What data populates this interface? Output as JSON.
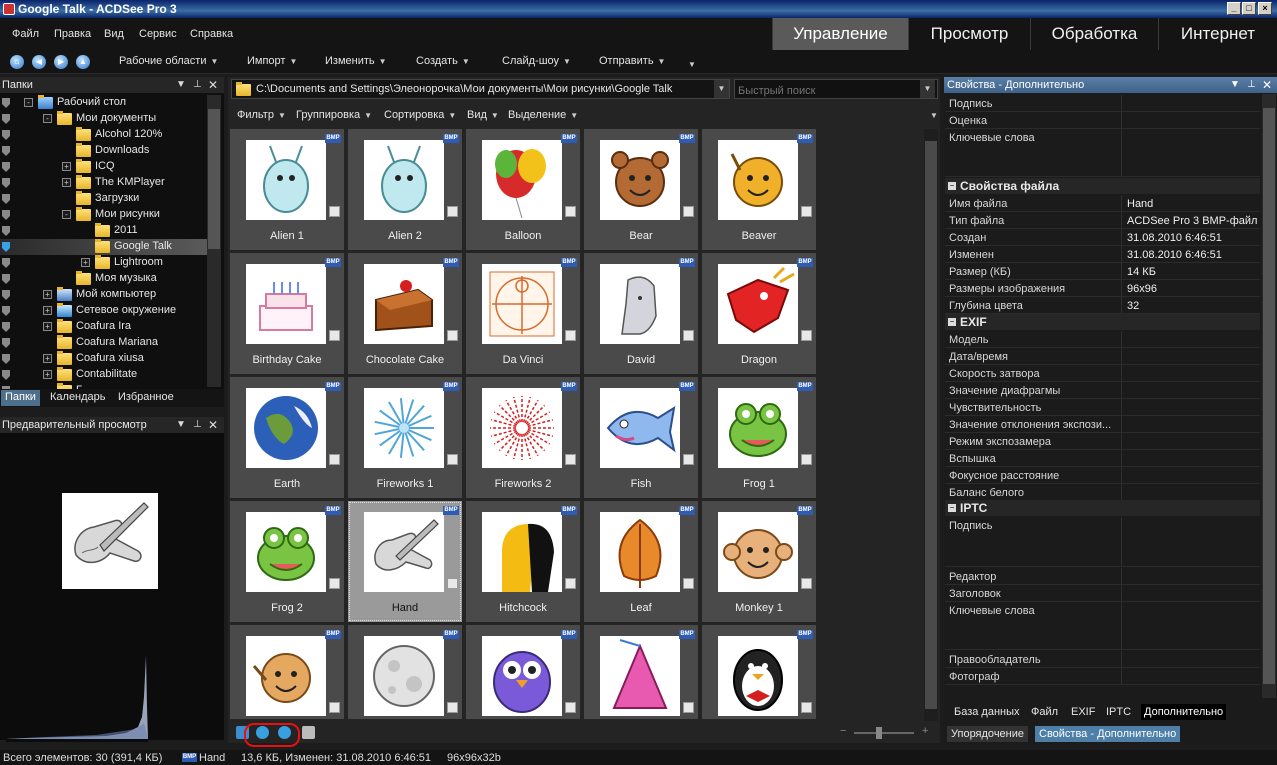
{
  "window": {
    "title": "Google Talk - ACDSee Pro 3"
  },
  "menu": [
    "Файл",
    "Правка",
    "Вид",
    "Сервис",
    "Справка"
  ],
  "modes": [
    "Управление",
    "Просмотр",
    "Обработка",
    "Интернет"
  ],
  "toolbar": [
    "Рабочие области",
    "Импорт",
    "Изменить",
    "Создать",
    "Слайд-шоу",
    "Отправить"
  ],
  "folders_panel": {
    "title": "Папки",
    "items": [
      "Рабочий стол",
      "Мои документы",
      "Alcohol 120%",
      "Downloads",
      "ICQ",
      "The KMPlayer",
      "Загрузки",
      "Мои рисунки",
      "2011",
      "Google Talk",
      "Lightroom",
      "Моя музыка",
      "Мой компьютер",
      "Сетевое окружение",
      "Coafura Ira",
      "Coafura Mariana",
      "Coafura xiusa",
      "Contabilitate",
      "Г"
    ]
  },
  "left_tabs": [
    "Папки",
    "Календарь",
    "Избранное"
  ],
  "preview_panel": {
    "title": "Предварительный просмотр"
  },
  "path": "C:\\Documents and Settings\\Элеонорочка\\Мои документы\\Мои рисунки\\Google Talk",
  "quick_search_placeholder": "Быстрый поиск",
  "filterbar": [
    "Фильтр",
    "Группировка",
    "Сортировка",
    "Вид",
    "Выделение"
  ],
  "badge_label": "BMP",
  "thumbnails": [
    "Alien 1",
    "Alien 2",
    "Balloon",
    "Bear",
    "Beaver",
    "Birthday Cake",
    "Chocolate Cake",
    "Da Vinci",
    "David",
    "Dragon",
    "Earth",
    "Fireworks 1",
    "Fireworks 2",
    "Fish",
    "Frog 1",
    "Frog 2",
    "Hand",
    "Hitchcock",
    "Leaf",
    "Monkey 1",
    "",
    "",
    "",
    "",
    ""
  ],
  "properties": {
    "title": "Свойства - Дополнительно",
    "top": [
      {
        "k": "Подпись",
        "v": ""
      },
      {
        "k": "Оценка",
        "v": ""
      },
      {
        "k": "Ключевые слова",
        "v": ""
      }
    ],
    "file_section": "Свойства файла",
    "file": [
      {
        "k": "Имя файла",
        "v": "Hand"
      },
      {
        "k": "Тип файла",
        "v": "ACDSee Pro 3 BMP-файл"
      },
      {
        "k": "Создан",
        "v": "31.08.2010 6:46:51"
      },
      {
        "k": "Изменен",
        "v": "31.08.2010 6:46:51"
      },
      {
        "k": "Размер (КБ)",
        "v": "14 КБ"
      },
      {
        "k": "Размеры изображения",
        "v": "96x96"
      },
      {
        "k": "Глубина цвета",
        "v": "32"
      }
    ],
    "exif_section": "EXIF",
    "exif": [
      "Модель",
      "Дата/время",
      "Скорость затвора",
      "Значение диафрагмы",
      "Чувствительность",
      "Значение отклонения экспози...",
      "Режим экспозамера",
      "Вспышка",
      "Фокусное расстояние",
      "Баланс белого"
    ],
    "iptc_section": "IPTC",
    "iptc": [
      "Подпись",
      "Редактор",
      "Заголовок",
      "Ключевые слова",
      "Правообладатель",
      "Фотограф"
    ],
    "tabs": [
      "База данных",
      "Файл",
      "EXIF",
      "IPTC",
      "Дополнительно"
    ],
    "bottom_buttons": [
      "Упорядочение",
      "Свойства - Дополнительно"
    ]
  },
  "status": {
    "total": "Всего элементов: 30  (391,4 КБ)",
    "file": "Hand",
    "info": "13,6 КБ, Изменен: 31.08.2010 6:46:51",
    "dims": "96x96x32b"
  }
}
